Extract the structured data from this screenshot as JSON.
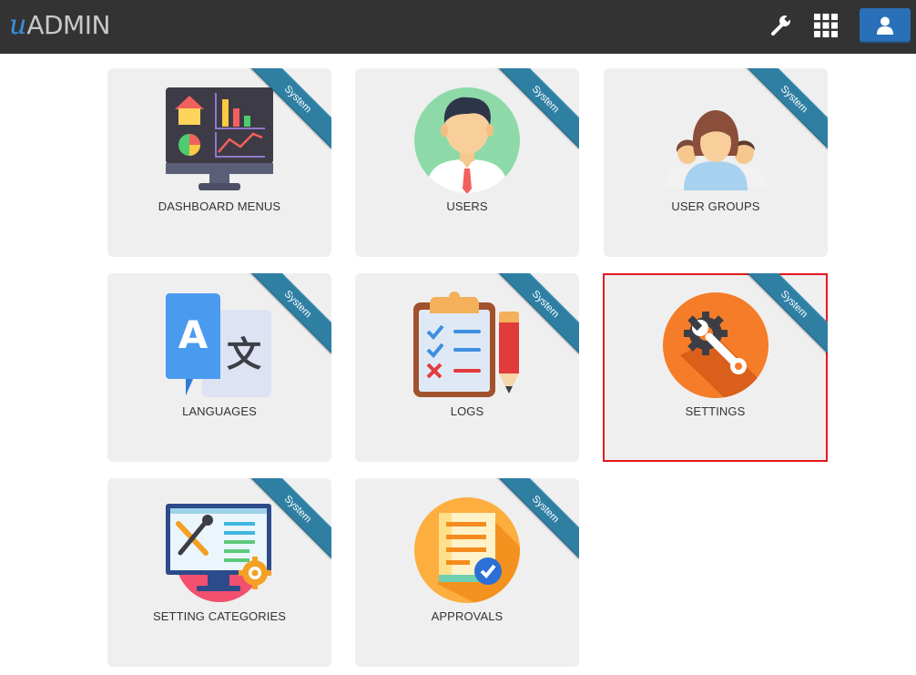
{
  "header": {
    "logo_prefix": "u",
    "logo_text": "ADMIN",
    "icons": {
      "tools": "wrench-icon",
      "apps": "grid-icon",
      "account": "user-icon"
    },
    "colors": {
      "bar": "#333333",
      "account_button": "#2a70b8"
    }
  },
  "tiles": [
    {
      "label": "DASHBOARD MENUS",
      "badge": "System",
      "icon": "dashboard-monitor-icon"
    },
    {
      "label": "USERS",
      "badge": "System",
      "icon": "user-avatar-icon"
    },
    {
      "label": "USER GROUPS",
      "badge": "System",
      "icon": "user-group-icon"
    },
    {
      "label": "LANGUAGES",
      "badge": "System",
      "icon": "translate-icon"
    },
    {
      "label": "LOGS",
      "badge": "System",
      "icon": "clipboard-checklist-icon"
    },
    {
      "label": "SETTINGS",
      "badge": "System",
      "icon": "gear-wrench-icon",
      "selected": true
    },
    {
      "label": "SETTING CATEGORIES",
      "badge": "System",
      "icon": "tools-monitor-icon"
    },
    {
      "label": "APPROVALS",
      "badge": "System",
      "icon": "approval-document-icon"
    }
  ],
  "colors": {
    "tile_bg": "#efefef",
    "ribbon": "#2f7fa3",
    "selection": "#e8161f"
  }
}
